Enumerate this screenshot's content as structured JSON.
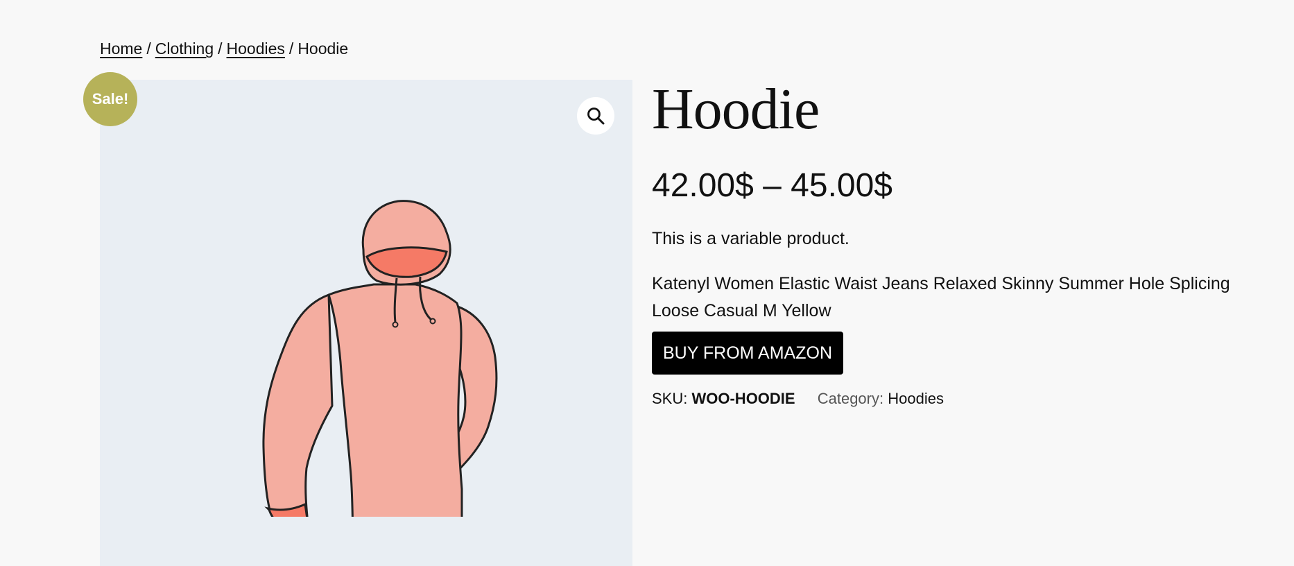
{
  "breadcrumb": {
    "items": [
      "Home",
      "Clothing",
      "Hoodies"
    ],
    "separator": "/",
    "current": "Hoodie"
  },
  "gallery": {
    "badge": "Sale!",
    "zoom_icon": "search-icon",
    "background_color": "#e9eef3"
  },
  "product": {
    "title": "Hoodie",
    "price_range": "42.00$ – 45.00$",
    "short_description": "This is a variable product.",
    "description": "Katenyl Women Elastic Waist Jeans Relaxed Skinny Summer Hole Splicing Loose Casual M Yellow",
    "buy_button_label": "BUY FROM AMAZON",
    "sku_label": "SKU:",
    "sku": "WOO-HOODIE",
    "category_label": "Category:",
    "category": "Hoodies"
  },
  "colors": {
    "badge": "#b6b259",
    "button": "#000000",
    "hoodie_fill": "#f4a99b",
    "hoodie_accent": "#f57a66"
  }
}
